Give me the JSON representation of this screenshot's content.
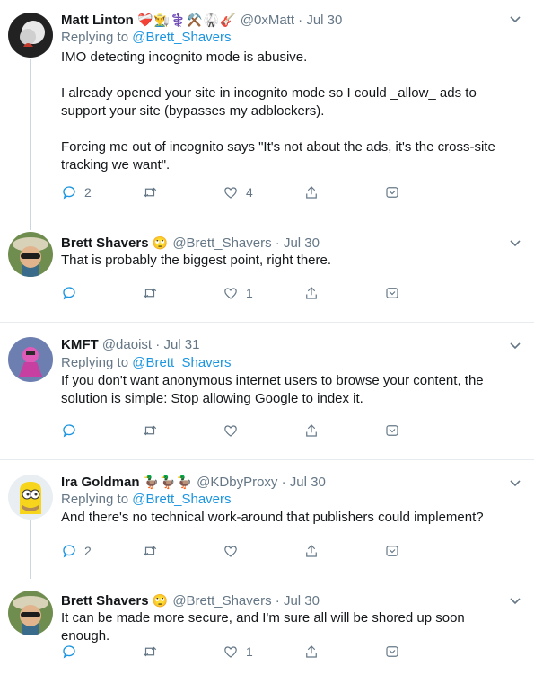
{
  "tweets": [
    {
      "name": "Matt Linton",
      "emoji": "❤️‍🩹👨‍🌾⚕️⚒️🥋🎸",
      "handle": "@0xMatt",
      "dot": "·",
      "time": "Jul 30",
      "replying_prefix": "Replying to ",
      "replying_to": "@Brett_Shavers",
      "text": "IMO detecting incognito mode is abusive.\n\nI already opened your site in incognito mode so I could _allow_ ads to support your site (bypasses my adblockers).\n\nForcing me out of incognito says \"It's not about the ads, it's the cross-site tracking we want\".",
      "reply_count": "2",
      "retweet_count": "",
      "like_count": "4"
    },
    {
      "name": "Brett Shavers",
      "emoji": "🙄",
      "handle": "@Brett_Shavers",
      "dot": "·",
      "time": "Jul 30",
      "text": "That is probably the biggest point, right there.",
      "reply_count": "",
      "retweet_count": "",
      "like_count": "1"
    },
    {
      "name": "KMFT",
      "emoji": "",
      "handle": "@daoist",
      "dot": "·",
      "time": "Jul 31",
      "replying_prefix": "Replying to ",
      "replying_to": "@Brett_Shavers",
      "text": "If you don't want anonymous internet users to browse your content, the solution is simple: Stop allowing Google to index it.",
      "reply_count": "",
      "retweet_count": "",
      "like_count": ""
    },
    {
      "name": "Ira Goldman",
      "emoji": "🦆🦆🦆",
      "handle": "@KDbyProxy",
      "dot": "·",
      "time": "Jul 30",
      "replying_prefix": "Replying to ",
      "replying_to": "@Brett_Shavers",
      "text": "And there's no technical work-around that publishers could implement?",
      "reply_count": "2",
      "retweet_count": "",
      "like_count": ""
    },
    {
      "name": "Brett Shavers",
      "emoji": "🙄",
      "handle": "@Brett_Shavers",
      "dot": "·",
      "time": "Jul 30",
      "text": "It can be made more secure, and I'm sure all will be shored up soon enough.",
      "reply_count": "",
      "retweet_count": "",
      "like_count": "1"
    }
  ],
  "colors": {
    "link": "#1b95e0",
    "secondary_text": "#657786",
    "divider": "#e6ecf0",
    "thread_line": "#ccd6dd"
  },
  "icons": {
    "reply": "reply-icon",
    "retweet": "retweet-icon",
    "like": "heart-icon",
    "share": "share-icon",
    "save": "save-icon",
    "menu": "chevron-down-icon"
  }
}
